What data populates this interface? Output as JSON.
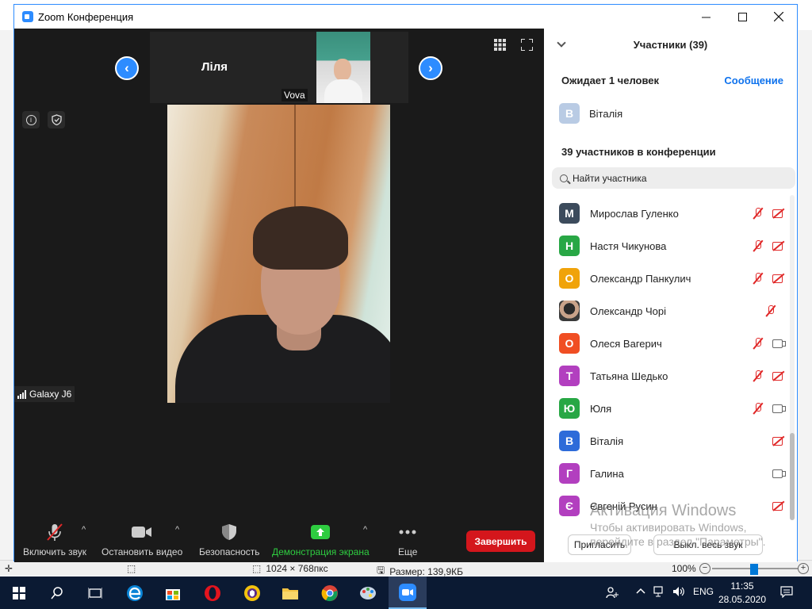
{
  "window": {
    "title": "Zoom Конференция"
  },
  "gallery": {
    "speaker_name": "Ліля",
    "thumb_name": "Vova",
    "device_label": "Galaxy J6"
  },
  "toolbar": {
    "audio_label": "Включить звук",
    "video_label": "Остановить видео",
    "security_label": "Безопасность",
    "share_label": "Демонстрация экрана",
    "more_label": "Еще",
    "end_label": "Завершить"
  },
  "participants": {
    "header": "Участники (39)",
    "waiting_label": "Ожидает 1 человек",
    "message_link": "Сообщение",
    "waiting_person": {
      "initial": "В",
      "name": "Віталія",
      "color": "#b9cbe4"
    },
    "in_conference_label": "39 участников в конференции",
    "search_placeholder": "Найти участника",
    "list": [
      {
        "initial": "М",
        "name": "Мирослав Гуленко",
        "color": "#3c4b5c",
        "mic": "off",
        "cam": "off"
      },
      {
        "initial": "Н",
        "name": "Настя Чикунова",
        "color": "#28a745",
        "mic": "off",
        "cam": "off"
      },
      {
        "initial": "О",
        "name": "Олександр Панкулич",
        "color": "#f0a30a",
        "mic": "off",
        "cam": "off"
      },
      {
        "initial": "",
        "name": "Олександр Чорі",
        "color": "#333333",
        "mic": "off",
        "cam": "none"
      },
      {
        "initial": "О",
        "name": "Олеся Вагерич",
        "color": "#f04e23",
        "mic": "off",
        "cam": "on"
      },
      {
        "initial": "Т",
        "name": "Татьяна Шедько",
        "color": "#b23fbf",
        "mic": "off",
        "cam": "off"
      },
      {
        "initial": "Ю",
        "name": "Юля",
        "color": "#28a745",
        "mic": "off",
        "cam": "on"
      },
      {
        "initial": "В",
        "name": "Віталія",
        "color": "#2d6bd9",
        "mic": "none",
        "cam": "off"
      },
      {
        "initial": "Г",
        "name": "Галина",
        "color": "#b23fbf",
        "mic": "none",
        "cam": "on"
      },
      {
        "initial": "Є",
        "name": "Євгеній Русин",
        "color": "#b23fbf",
        "mic": "none",
        "cam": "off"
      }
    ],
    "invite_label": "Пригласить",
    "mute_all_label": "Выкл. весь звук"
  },
  "watermark": {
    "line1": "Активация Windows",
    "line2": "Чтобы активировать Windows,",
    "line3": "перейдите в раздел \"Параметры\"."
  },
  "paint_status": {
    "dimensions": "1024 × 768пкс",
    "size": "Размер: 139,9КБ",
    "zoom": "100%"
  },
  "taskbar": {
    "lang": "ENG",
    "time": "11:35",
    "date": "28.05.2020"
  }
}
